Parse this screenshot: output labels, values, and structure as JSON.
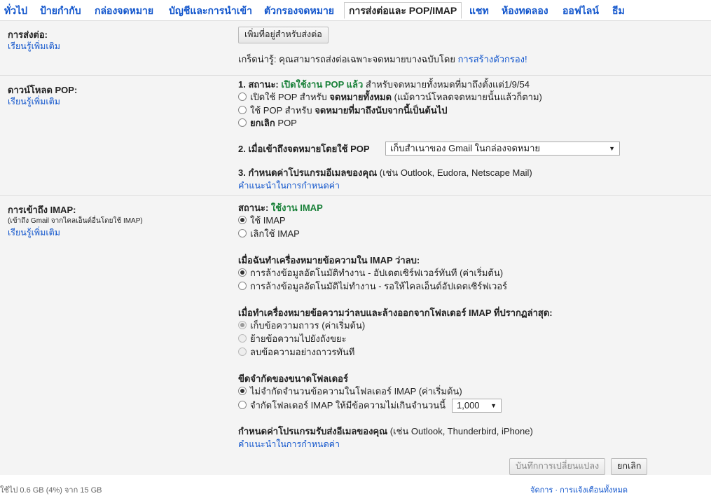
{
  "tabs": [
    "ทั่วไป",
    "ป้ายกำกับ",
    "กล่องจดหมาย",
    "บัญชีและการนำเข้า",
    "ตัวกรองจดหมาย",
    "การส่งต่อและ POP/IMAP",
    "แชท",
    "ห้องทดลอง",
    "ออฟไลน์",
    "ธีม"
  ],
  "active_tab": "การส่งต่อและ POP/IMAP",
  "forwarding": {
    "label": "การส่งต่อ:",
    "learn_more": "เรียนรู้เพิ่มเติม",
    "add_button": "เพิ่มที่อยู่สำหรับส่งต่อ",
    "tip": "เกร็ดน่ารู้: คุณสามารถส่งต่อเฉพาะจดหมายบางฉบับโดย ",
    "tip_link": "การสร้างตัวกรอง!"
  },
  "pop": {
    "label": "ดาวน์โหลด POP:",
    "learn_more": "เรียนรู้เพิ่มเติม",
    "status_prefix": "1. สถานะ: ",
    "status_value": "เปิดใช้งาน POP แล้ว",
    "status_suffix": " สำหรับจดหมายทั้งหมดที่มาถึงตั้งแต่1/9/54",
    "opt1_a": "เปิดใช้ POP สำหรับ ",
    "opt1_b": "จดหมายทั้งหมด",
    "opt1_c": " (แม้ดาวน์โหลดจดหมายนั้นแล้วก็ตาม)",
    "opt2_a": "ใช้ POP สำหรับ ",
    "opt2_b": "จดหมายที่มาถึงนับจากนี้เป็นต้นไป",
    "opt3_a": "ยกเลิก",
    "opt3_b": " POP",
    "step2": "2. เมื่อเข้าถึงจดหมายโดยใช้ POP",
    "step2_select": "เก็บสำเนาของ Gmail ในกล่องจดหมาย",
    "step3_b": "3. กำหนดค่าโปรแกรมอีเมลของคุณ",
    "step3_rest": " (เช่น Outlook, Eudora, Netscape Mail)",
    "config_link": "คำแนะนำในการกำหนดค่า"
  },
  "imap": {
    "label": "การเข้าถึง IMAP:",
    "sublabel": "(เข้าถึง Gmail จากไคลเอ็นต์อื่นโดยใช้ IMAP)",
    "learn_more": "เรียนรู้เพิ่มเติม",
    "status_prefix": "สถานะ: ",
    "status_value": "ใช้งาน IMAP",
    "enable": "ใช้ IMAP",
    "disable": "เลิกใช้ IMAP",
    "deleted_heading": "เมื่อฉันทำเครื่องหมายข้อความใน IMAP ว่าลบ:",
    "expunge_on": "การล้างข้อมูลอัตโนมัติทำงาน - อัปเดตเซิร์ฟเวอร์ทันที (ค่าเริ่มต้น)",
    "expunge_off": "การล้างข้อมูลอัตโนมัติไม่ทำงาน - รอให้ไคลเอ็นต์อัปเดตเซิร์ฟเวอร์",
    "expunged_heading": "เมื่อทำเครื่องหมายข้อความว่าลบและล้างออกจากโฟลเดอร์ IMAP ที่ปรากฏล่าสุด:",
    "archive": "เก็บข้อความถาวร (ค่าเริ่มต้น)",
    "trash": "ย้ายข้อความไปยังถังขยะ",
    "delete_forever": "ลบข้อความอย่างถาวรทันที",
    "folder_heading": "ขีดจำกัดของขนาดโฟลเดอร์",
    "no_limit": "ไม่จำกัดจำนวนข้อความในโฟลเดอร์ IMAP (ค่าเริ่มต้น)",
    "limit": "จำกัดโฟลเดอร์ IMAP ให้มีข้อความไม่เกินจำนวนนี้",
    "limit_value": "1,000",
    "client_b": "กำหนดค่าโปรแกรมรับส่งอีเมลของคุณ",
    "client_rest": " (เช่น Outlook, Thunderbird, iPhone)",
    "config_link": "คำแนะนำในการกำหนดค่า"
  },
  "buttons": {
    "save": "บันทึกการเปลี่ยนแปลง",
    "cancel": "ยกเลิก"
  },
  "footer": {
    "storage": "ใช้ไป 0.6 GB (4%) จาก 15 GB",
    "right": "จัดการ · การแจ้งเตือนทั้งหมด"
  }
}
